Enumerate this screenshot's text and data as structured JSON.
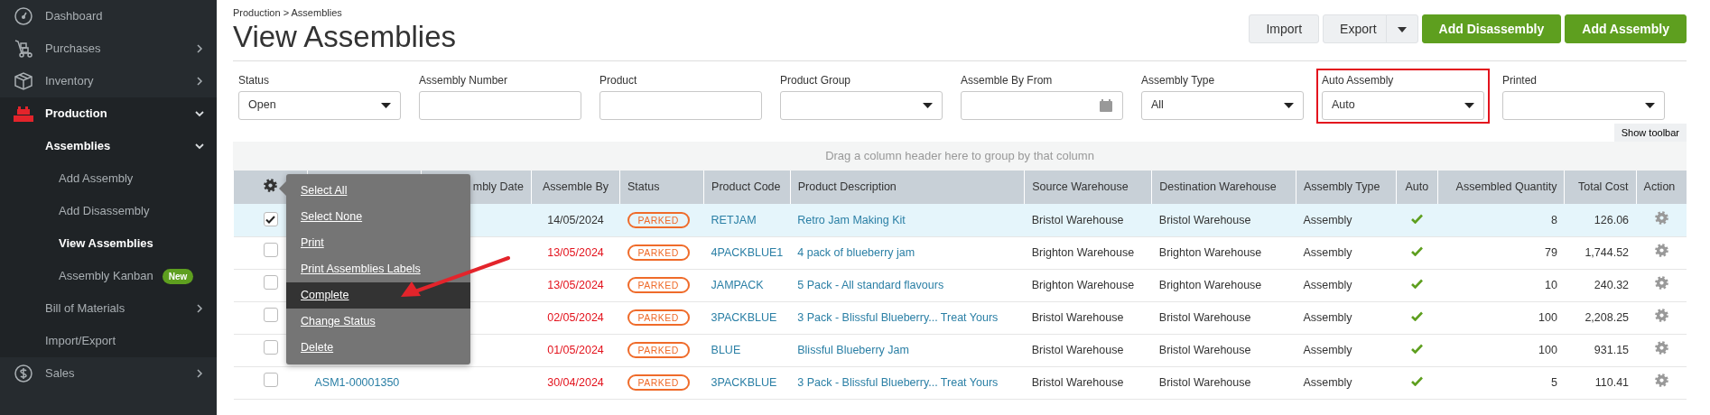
{
  "sidebar": {
    "items": [
      {
        "label": "Dashboard",
        "expandable": false,
        "expanded": false,
        "selected": false
      },
      {
        "label": "Purchases",
        "expandable": true,
        "expanded": false,
        "selected": false
      },
      {
        "label": "Inventory",
        "expandable": true,
        "expanded": false,
        "selected": false
      },
      {
        "label": "Production",
        "expandable": true,
        "expanded": true,
        "selected": true,
        "children": [
          {
            "label": "Assemblies",
            "expandable": true,
            "expanded": true,
            "selected": true,
            "children": [
              {
                "label": "Add Assembly",
                "expandable": false,
                "expanded": false,
                "selected": false
              },
              {
                "label": "Add Disassembly",
                "expandable": false,
                "expanded": false,
                "selected": false
              },
              {
                "label": "View Assemblies",
                "expandable": false,
                "expanded": false,
                "selected": true
              },
              {
                "label": "Assembly Kanban",
                "expandable": false,
                "expanded": false,
                "selected": false,
                "badge": "New"
              }
            ]
          },
          {
            "label": "Bill of Materials",
            "expandable": true,
            "expanded": false,
            "selected": false
          },
          {
            "label": "Import/Export",
            "expandable": false,
            "expanded": false,
            "selected": false
          }
        ]
      },
      {
        "label": "Sales",
        "expandable": true,
        "expanded": false,
        "selected": false
      }
    ]
  },
  "header": {
    "breadcrumb": "Production > Assemblies",
    "title": "View Assemblies",
    "buttons": [
      {
        "label": "Import",
        "kind": "plain"
      },
      {
        "label": "Export",
        "kind": "split"
      },
      {
        "label": "Add Disassembly",
        "kind": "primary"
      },
      {
        "label": "Add Assembly",
        "kind": "primary"
      }
    ]
  },
  "filters": [
    {
      "label": "Status",
      "kind": "select",
      "value": "Open",
      "highlighted": false
    },
    {
      "label": "Assembly Number",
      "kind": "text",
      "highlighted": false
    },
    {
      "label": "Product",
      "kind": "text",
      "highlighted": false
    },
    {
      "label": "Product Group",
      "kind": "select",
      "highlighted": false
    },
    {
      "label": "Assemble By From",
      "kind": "date",
      "highlighted": false
    },
    {
      "label": "Assembly Type",
      "kind": "select",
      "value": "All",
      "highlighted": false
    },
    {
      "label": "Auto Assembly",
      "kind": "select",
      "value": "Auto",
      "highlighted": true
    },
    {
      "label": "Printed",
      "kind": "select",
      "highlighted": false
    }
  ],
  "toolbar_button": "Show toolbar",
  "grid": {
    "group_hint": "Drag a column header here to group by that column",
    "columns": [
      "mbly Date",
      "Assemble By",
      "Status",
      "Product Code",
      "Product Description",
      "Source Warehouse",
      "Destination Warehouse",
      "Assembly Type",
      "Auto",
      "Assembled Quantity",
      "Total Cost",
      "Action"
    ],
    "rows": [
      {
        "checked": true,
        "assemble_by": "14/05/2024",
        "overdue": false,
        "status": "PARKED",
        "product_code": "RETJAM",
        "product_description": "Retro Jam Making Kit",
        "source_warehouse": "Bristol Warehouse",
        "destination_warehouse": "Bristol Warehouse",
        "assembly_type": "Assembly",
        "auto": true,
        "assembled_quantity": "8",
        "total_cost": "126.06"
      },
      {
        "checked": false,
        "assemble_by": "13/05/2024",
        "overdue": true,
        "status": "PARKED",
        "product_code": "4PACKBLUE1",
        "product_description": "4 pack of blueberry jam",
        "source_warehouse": "Brighton Warehouse",
        "destination_warehouse": "Brighton Warehouse",
        "assembly_type": "Assembly",
        "auto": true,
        "assembled_quantity": "79",
        "total_cost": "1,744.52"
      },
      {
        "checked": false,
        "assemble_by": "13/05/2024",
        "overdue": true,
        "status": "PARKED",
        "product_code": "JAMPACK",
        "product_description": "5 Pack - All standard flavours",
        "source_warehouse": "Brighton Warehouse",
        "destination_warehouse": "Brighton Warehouse",
        "assembly_type": "Assembly",
        "auto": true,
        "assembled_quantity": "10",
        "total_cost": "240.32"
      },
      {
        "checked": false,
        "assemble_by": "02/05/2024",
        "overdue": true,
        "status": "PARKED",
        "product_code": "3PACKBLUE",
        "product_description": "3 Pack - Blissful Blueberry... Treat Yours",
        "source_warehouse": "Bristol Warehouse",
        "destination_warehouse": "Bristol Warehouse",
        "assembly_type": "Assembly",
        "auto": true,
        "assembled_quantity": "100",
        "total_cost": "2,208.25"
      },
      {
        "checked": false,
        "assemble_by": "01/05/2024",
        "overdue": true,
        "status": "PARKED",
        "product_code": "BLUE",
        "product_description": "Blissful Blueberry Jam",
        "source_warehouse": "Bristol Warehouse",
        "destination_warehouse": "Bristol Warehouse",
        "assembly_type": "Assembly",
        "auto": true,
        "assembled_quantity": "100",
        "total_cost": "931.15"
      },
      {
        "checked": false,
        "assembly_number": "ASM1-00001350",
        "assemble_by": "30/04/2024",
        "overdue": true,
        "status": "PARKED",
        "product_code": "3PACKBLUE",
        "product_description": "3 Pack - Blissful Blueberry... Treat Yours",
        "source_warehouse": "Bristol Warehouse",
        "destination_warehouse": "Bristol Warehouse",
        "assembly_type": "Assembly",
        "auto": true,
        "assembled_quantity": "5",
        "total_cost": "110.41"
      }
    ],
    "row_menu": {
      "items": [
        {
          "label": "Select All",
          "selected": false,
          "pointed": false
        },
        {
          "label": "Select None",
          "selected": false,
          "pointed": false
        },
        {
          "label": "Print",
          "selected": false,
          "pointed": false
        },
        {
          "label": "Print Assemblies Labels",
          "selected": false,
          "pointed": false
        },
        {
          "label": "Complete",
          "selected": true,
          "pointed": true
        },
        {
          "label": "Change Status",
          "selected": false,
          "pointed": false
        },
        {
          "label": "Delete",
          "selected": false,
          "pointed": false
        }
      ]
    }
  }
}
